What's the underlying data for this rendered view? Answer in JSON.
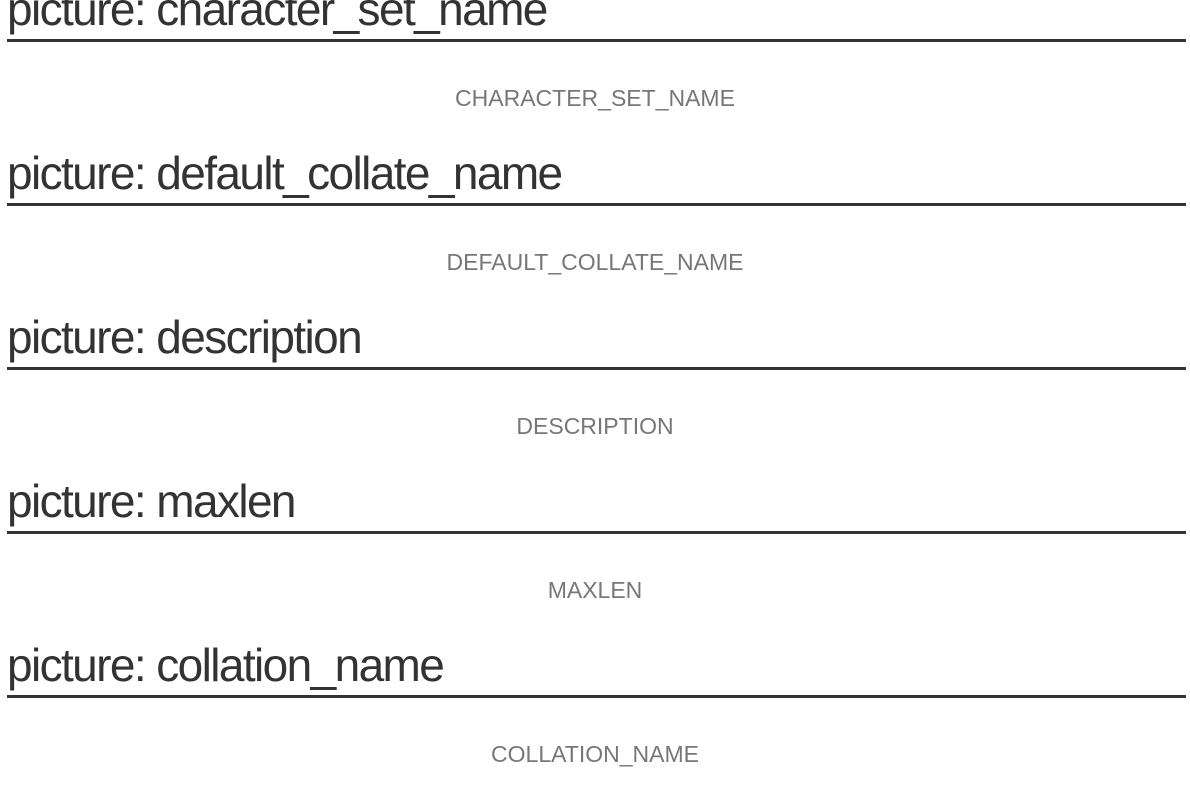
{
  "sections": [
    {
      "heading": "picture: character_set_name",
      "caption": "CHARACTER_SET_NAME"
    },
    {
      "heading": "picture: default_collate_name",
      "caption": "DEFAULT_COLLATE_NAME"
    },
    {
      "heading": "picture: description",
      "caption": "DESCRIPTION"
    },
    {
      "heading": "picture: maxlen",
      "caption": "MAXLEN"
    },
    {
      "heading": "picture: collation_name",
      "caption": "COLLATION_NAME"
    }
  ]
}
